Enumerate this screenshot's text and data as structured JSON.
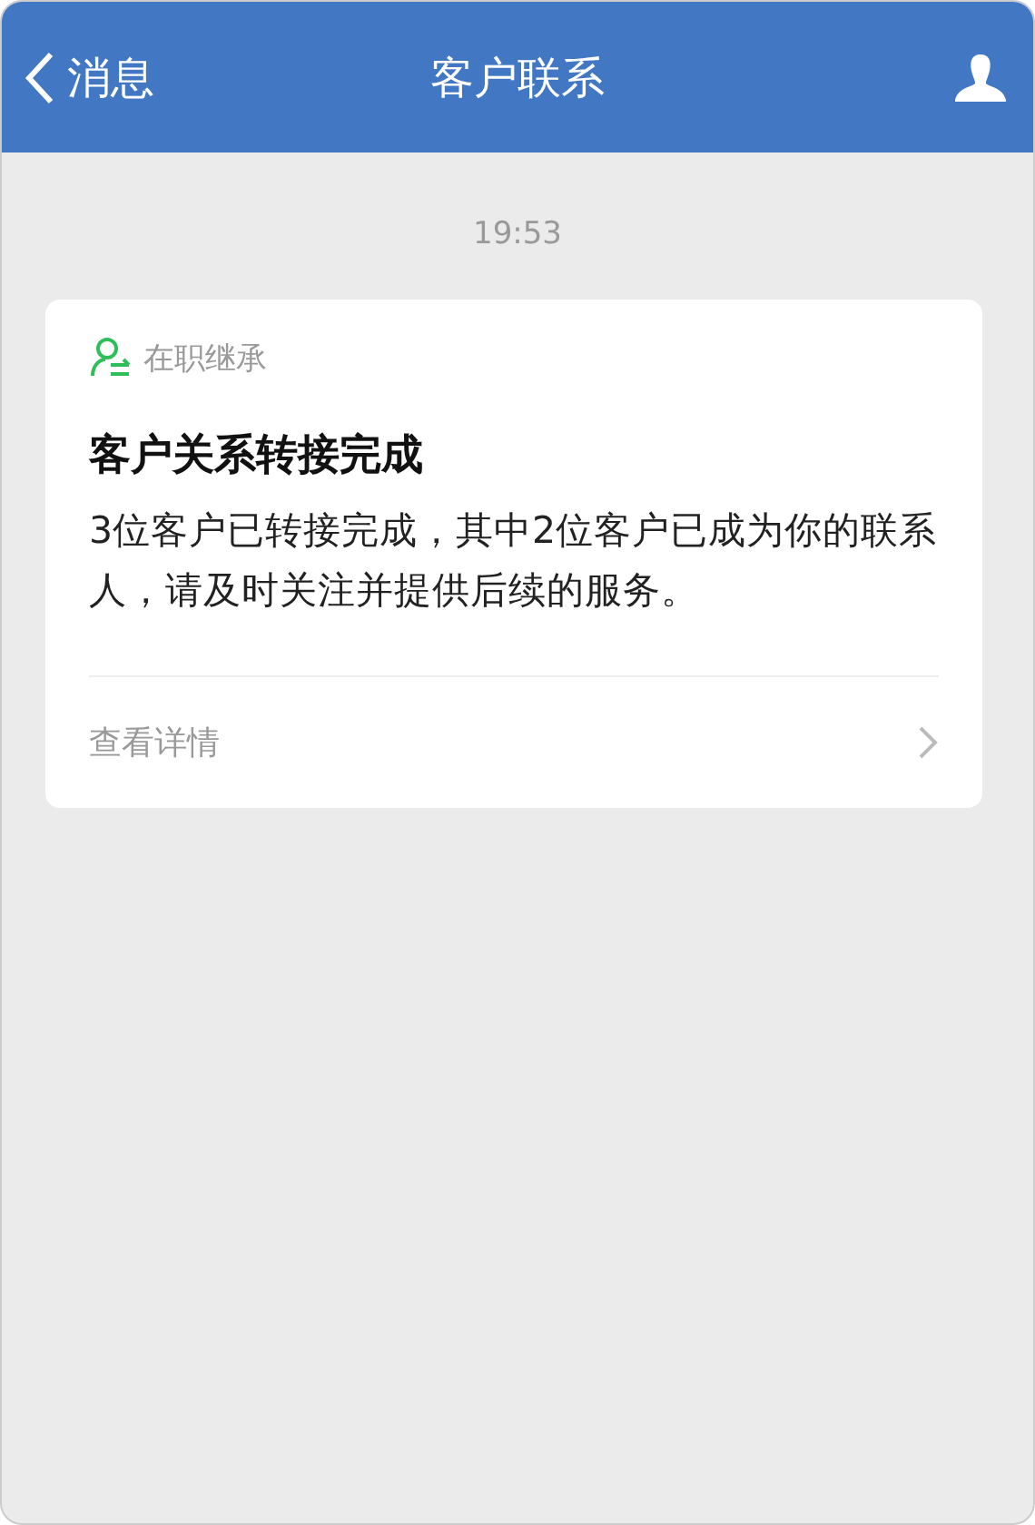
{
  "nav_bar": {
    "back_label": "消息",
    "title": "客户联系"
  },
  "timestamp": "19:53",
  "card": {
    "tag": "在职继承",
    "title": "客户关系转接完成",
    "body": "3位客户已转接完成，其中2位客户已成为你的联系人，请及时关注并提供后续的服务。",
    "link": "查看详情"
  }
}
